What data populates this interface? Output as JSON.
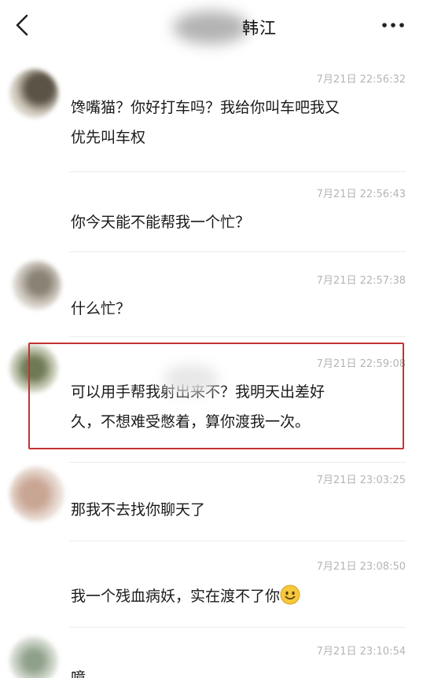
{
  "header": {
    "title": "韩江",
    "back_icon": "chevron-left-icon",
    "more_icon": "more-dots-icon"
  },
  "messages": [
    {
      "time": "7月21日 22:56:32",
      "lines": [
        "馋嘴猫？你好打车吗？我给你叫车吧我又",
        "优先叫车权"
      ]
    },
    {
      "time": "7月21日 22:56:43",
      "lines": [
        "你今天能不能帮我一个忙？"
      ]
    },
    {
      "time": "7月21日 22:57:38",
      "lines": [
        "什么忙？"
      ]
    },
    {
      "time": "7月21日 22:59:08",
      "lines": [
        "可以用手帮我射出来不？我明天出差好",
        "久，不想难受憋着，算你渡我一次。"
      ]
    },
    {
      "time": "7月21日 23:03:25",
      "lines": [
        "那我不去找你聊天了"
      ]
    },
    {
      "time": "7月21日 23:08:50",
      "lines": [
        "我一个残血病妖，实在渡不了你"
      ]
    },
    {
      "time": "7月21日 23:10:54",
      "lines": [
        "噫"
      ]
    }
  ],
  "colors": {
    "highlight_border": "#c43232",
    "timestamp": "#b5b5b5",
    "divider": "#ececec"
  },
  "emoji": "smiling-face-icon"
}
